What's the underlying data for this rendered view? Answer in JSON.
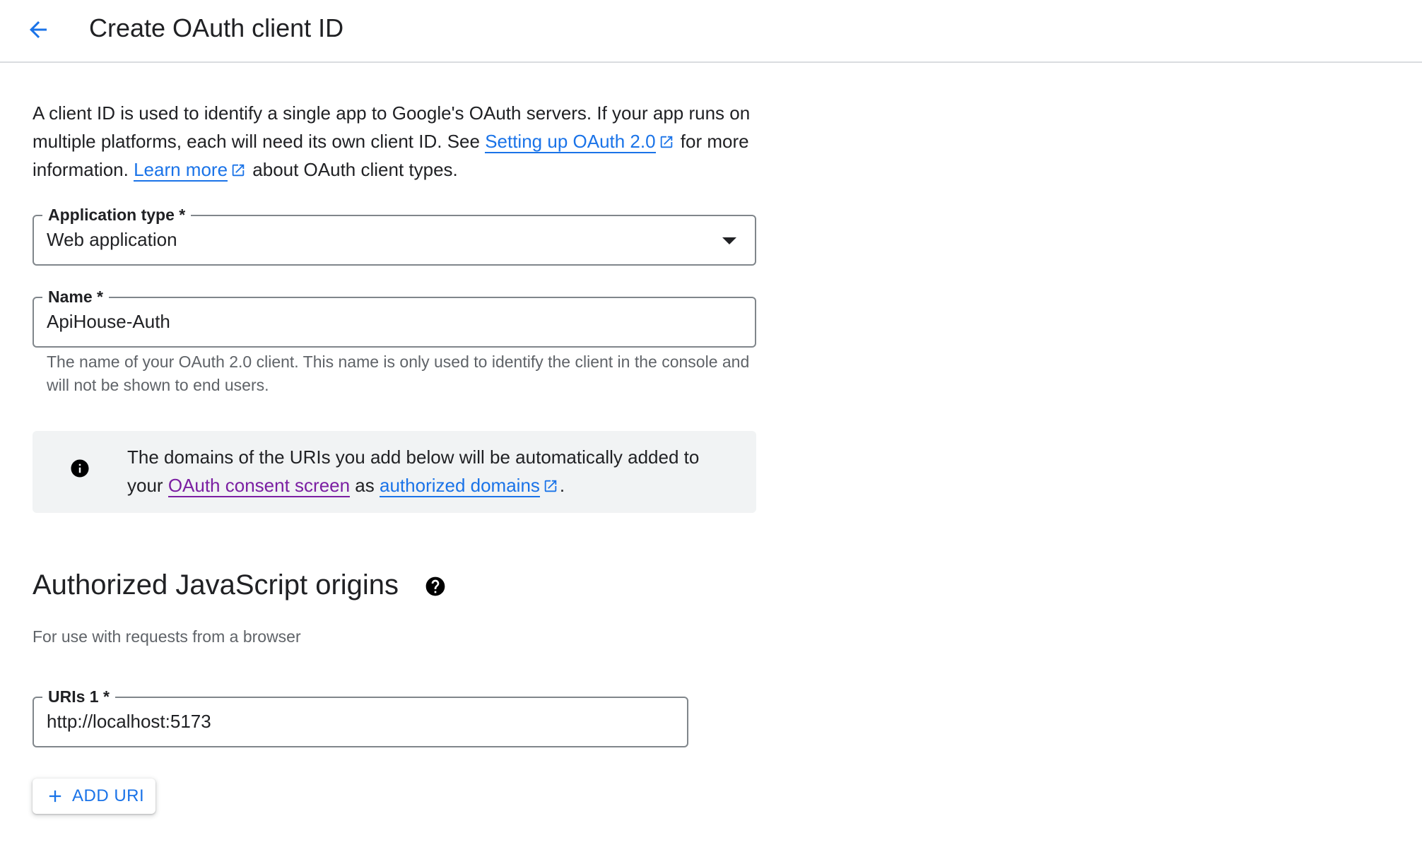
{
  "header": {
    "title": "Create OAuth client ID",
    "back_icon": "arrow-left-icon"
  },
  "intro": {
    "text_1": "A client ID is used to identify a single app to Google's OAuth servers. If your app runs on multiple platforms, each will need its own client ID. See ",
    "link_1": "Setting up OAuth 2.0",
    "text_2": " for more information. ",
    "link_2": "Learn more",
    "text_3": " about OAuth client types."
  },
  "application_type": {
    "label": "Application type *",
    "value": "Web application"
  },
  "name_field": {
    "label": "Name *",
    "value": "ApiHouse-Auth",
    "hint": "The name of your OAuth 2.0 client. This name is only used to identify the client in the console and will not be shown to end users."
  },
  "info_banner": {
    "text_1": "The domains of the URIs you add below will be automatically added to your ",
    "link_1": "OAuth consent screen",
    "text_2": " as ",
    "link_2": "authorized domains",
    "text_3": "."
  },
  "js_origins": {
    "title": "Authorized JavaScript origins",
    "description": "For use with requests from a browser",
    "uri_label": "URIs 1 *",
    "uri_value": "http://localhost:5173",
    "add_button": "ADD URI"
  },
  "colors": {
    "link": "#1a73e8",
    "visited_link": "#7b1fa2",
    "text": "#202124",
    "secondary_text": "#5f6368",
    "info_bg": "#f1f3f4",
    "border": "#80868b"
  }
}
